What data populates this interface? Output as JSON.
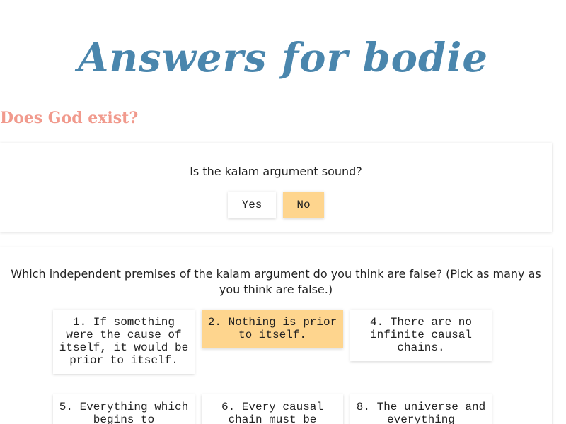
{
  "site": {
    "title": "Answers for bodie"
  },
  "section": {
    "heading": "Does God exist?"
  },
  "question1": {
    "text": "Is the kalam argument sound?",
    "options": [
      {
        "label": "Yes",
        "selected": false
      },
      {
        "label": "No",
        "selected": true
      }
    ]
  },
  "question2": {
    "text": "Which independent premises of the kalam argument do you think are false? (Pick as many as you think are false.)",
    "premises": [
      {
        "label": "1. If something were the cause of itself, it would be prior to itself.",
        "selected": false
      },
      {
        "label": "2. Nothing is prior to itself.",
        "selected": true
      },
      {
        "label": "4. There are no infinite causal chains.",
        "selected": false
      },
      {
        "label": "5. Everything which begins to",
        "selected": false
      },
      {
        "label": "6. Every causal chain must be",
        "selected": false
      },
      {
        "label": "8. The universe and everything",
        "selected": false
      }
    ]
  },
  "colors": {
    "title": "#4a86ad",
    "heading": "#f19a8d",
    "selected_bg": "#fed58e",
    "card_bg": "#ffffff"
  }
}
